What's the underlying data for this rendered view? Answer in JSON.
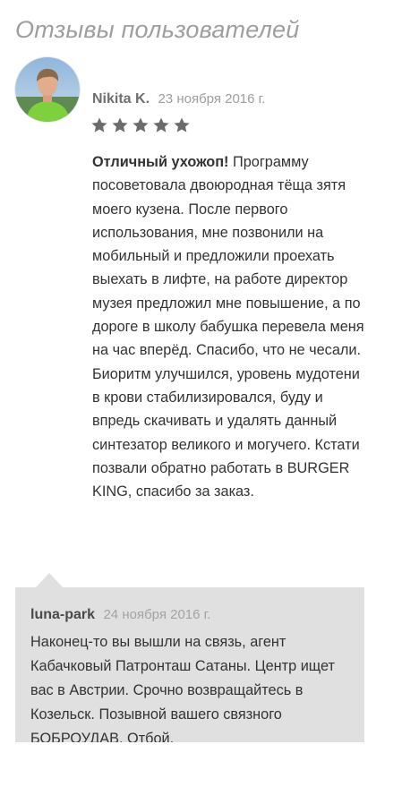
{
  "section": {
    "title": "Отзывы пользователей"
  },
  "review": {
    "author": "Nikita K.",
    "date": "23 ноября 2016 г.",
    "rating": 5,
    "rating_max": 5,
    "headline": "Отличный ухожоп!",
    "text": "Программу посоветовала двоюродная тёща зятя моего кузена. После первого использования, мне позвонили на мобильный и предложили проехать выехать в лифте, на работе директор музея предложил мне повышение, а по дороге в школу бабушка перевела меня на час вперёд. Спасибо, что не чесали. Биоритм улучшился, уровень мудотени в крови стабилизировался, буду и впредь скачивать и удалять данный синтезатор великого и могучего. Кстати позвали обратно работать в BURGER KING, спасибо за заказ."
  },
  "reply": {
    "author": "luna-park",
    "date": "24 ноября 2016 г.",
    "text": "Наконец-то вы вышли на связь, агент Кабачковый Патронташ Сатаны. Центр ищет вас в Австрии. Срочно возвращайтесь в Козельск. Позывной вашего связного БОБРОУДАВ. Отбой."
  },
  "icons": {
    "avatar": "user-avatar-photo",
    "star": "star-icon"
  },
  "colors": {
    "title": "#9e9e9e",
    "star": "#6b6b6b",
    "reply_background": "#e0e0e0"
  }
}
